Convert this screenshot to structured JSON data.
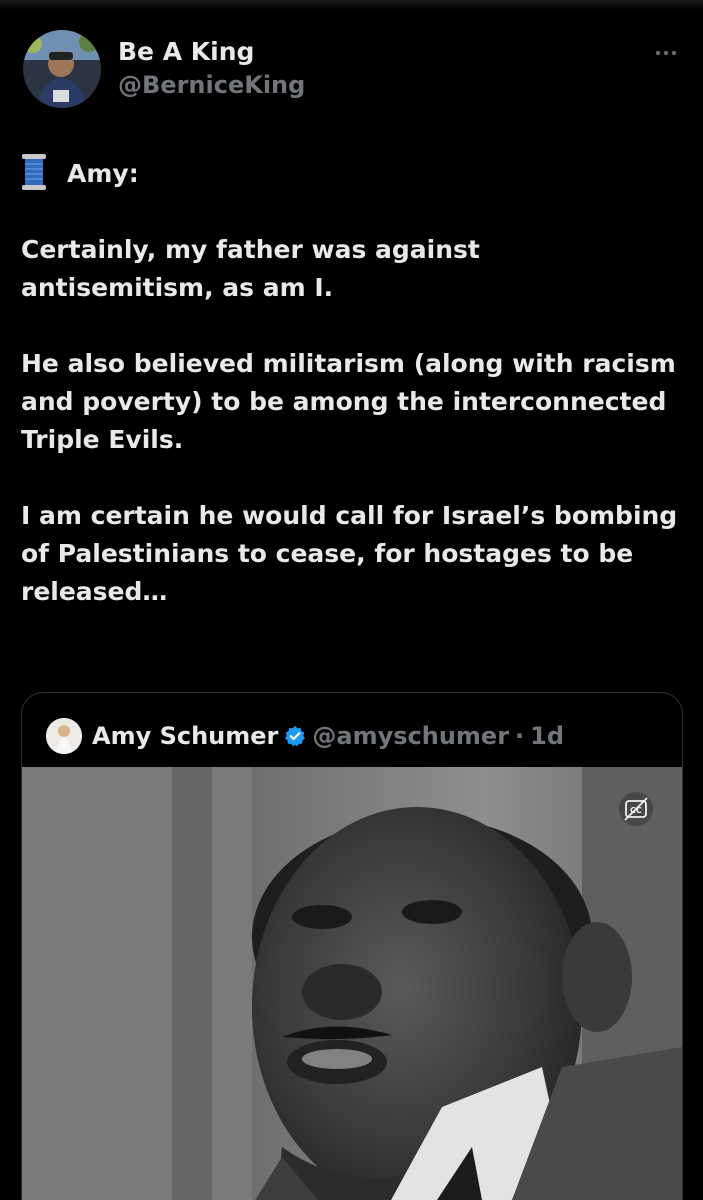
{
  "author": {
    "name": "Be A King",
    "handle": "@BerniceKing"
  },
  "post": {
    "thread_icon": "spool-of-thread-icon",
    "intro": "Amy:",
    "paragraphs": [
      "Certainly, my father was against antisemitism, as am I.",
      "He also believed militarism (along with racism and poverty) to be among the interconnected Triple Evils.",
      "I am certain he would call for Israel’s bombing of Palestinians to cease, for hostages to be released…"
    ]
  },
  "quoted_post": {
    "name": "Amy Schumer",
    "handle": "@amyschumer",
    "separator": "·",
    "time": "1d",
    "verified_icon": "verified-badge-icon",
    "media_icon": "captions-icon"
  },
  "colors": {
    "background": "#000000",
    "text": "#e7e9ea",
    "secondary": "#71767b",
    "verified": "#1d9bf0",
    "border": "#2f3336"
  }
}
